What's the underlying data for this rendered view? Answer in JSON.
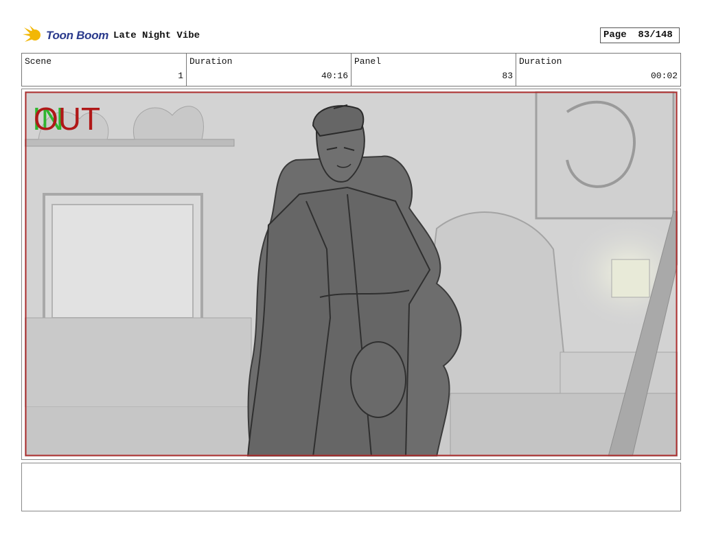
{
  "header": {
    "logo_text": "Toon Boom",
    "project_title": "Late Night Vibe",
    "page_label": "Page",
    "page_value": "83/148"
  },
  "info": [
    {
      "label": "Scene",
      "value": "1"
    },
    {
      "label": "Duration",
      "value": "40:16"
    },
    {
      "label": "Panel",
      "value": "83"
    },
    {
      "label": "Duration",
      "value": "00:02"
    }
  ],
  "panel": {
    "in_marker": "IN",
    "out_marker": "OUT",
    "caption": ""
  },
  "colors": {
    "logo_blue": "#2a3a8c",
    "logo_yellow": "#f2b705",
    "in_green": "#2fb52f",
    "out_red": "#b01818",
    "safe_frame": "#b03030"
  }
}
